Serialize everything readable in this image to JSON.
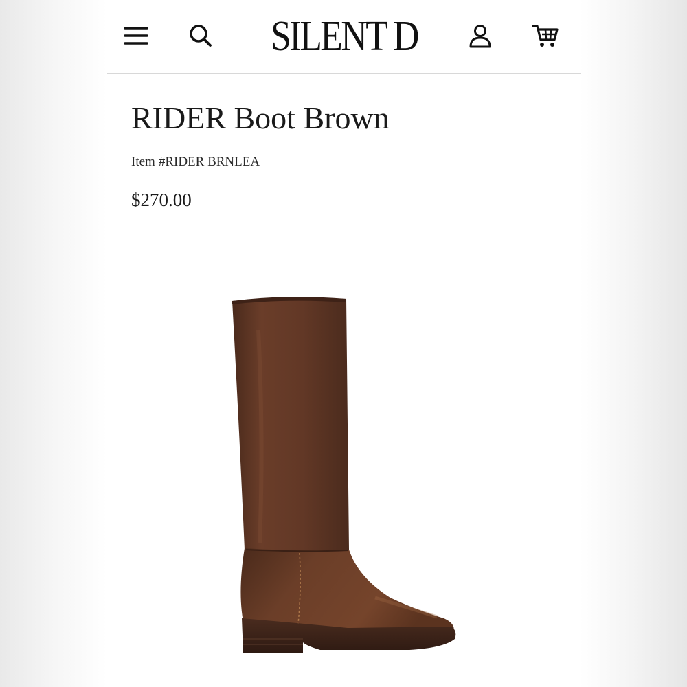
{
  "header": {
    "brand": "SILENT D",
    "menu_icon": "hamburger-menu-icon",
    "search_icon": "search-icon",
    "account_icon": "user-account-icon",
    "cart_icon": "shopping-cart-icon"
  },
  "product": {
    "title": "RIDER Boot Brown",
    "sku_label": "Item",
    "sku": "#RIDER BRNLEA",
    "price": "$270.00",
    "image_subject": "brown leather knee-high riding boot"
  },
  "colors": {
    "background": "#ffffff",
    "text": "#1a1a1a",
    "divider": "#d8d8d8",
    "boot_leather": "#5c3524",
    "boot_sole": "#3a2218"
  }
}
